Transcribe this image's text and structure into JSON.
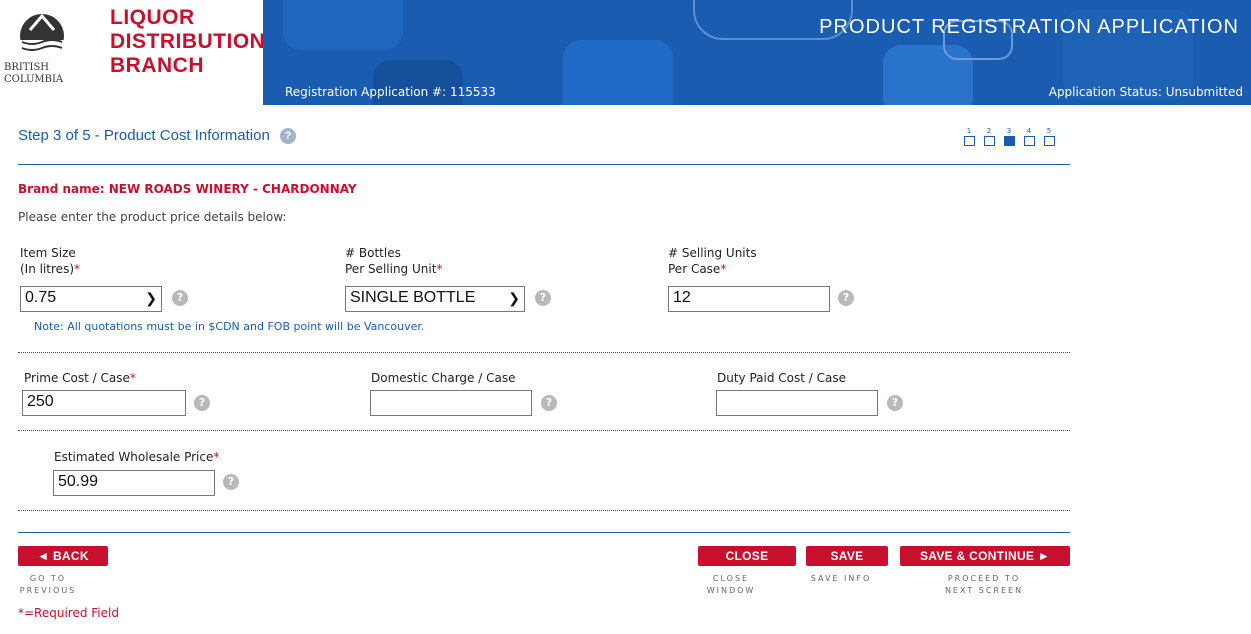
{
  "header": {
    "logo_text_line1": "British",
    "logo_text_line2": "Columbia",
    "branch_line1": "LIQUOR",
    "branch_line2": "DISTRIBUTION",
    "branch_line3": "BRANCH",
    "app_title": "PRODUCT REGISTRATION APPLICATION",
    "registration_label": "Registration Application #: 115533",
    "status_label": "Application Status: Unsubmitted"
  },
  "step": {
    "title": "Step 3 of 5 - Product Cost Information",
    "help_glyph": "?",
    "current": 3,
    "steps": [
      "1",
      "2",
      "3",
      "4",
      "5"
    ]
  },
  "form": {
    "brand_name": "Brand name: NEW ROADS WINERY - CHARDONNAY",
    "instructions": "Please enter the product price details below:",
    "item_size": {
      "label1": "Item Size",
      "label2": "(In litres)",
      "value": "0.75"
    },
    "bottles": {
      "label1": "# Bottles",
      "label2": "Per Selling Unit",
      "value": "SINGLE BOTTLE"
    },
    "selling_units": {
      "label1": "# Selling Units",
      "label2": "Per Case",
      "value": "12"
    },
    "note": "Note: All quotations must be in $CDN and FOB point will be Vancouver.",
    "prime_cost": {
      "label": "Prime Cost / Case",
      "value": "250"
    },
    "domestic_charge": {
      "label": "Domestic Charge / Case",
      "value": ""
    },
    "duty_paid": {
      "label": "Duty Paid Cost / Case",
      "value": ""
    },
    "wholesale": {
      "label": "Estimated Wholesale Price",
      "value": "50.99"
    },
    "required_marker": "*"
  },
  "footer": {
    "back_label": "◄ BACK",
    "back_caption1": "GO TO",
    "back_caption2": "PREVIOUS",
    "close_label": "CLOSE",
    "close_caption1": "CLOSE",
    "close_caption2": "WINDOW",
    "save_label": "SAVE",
    "save_caption": "SAVE INFO",
    "continue_label": "SAVE & CONTINUE ►",
    "continue_caption1": "PROCEED TO",
    "continue_caption2": "NEXT SCREEN",
    "required_note": "*=Required Field"
  },
  "colors": {
    "brand_red": "#c8102e",
    "brand_blue": "#1a5cb0"
  }
}
